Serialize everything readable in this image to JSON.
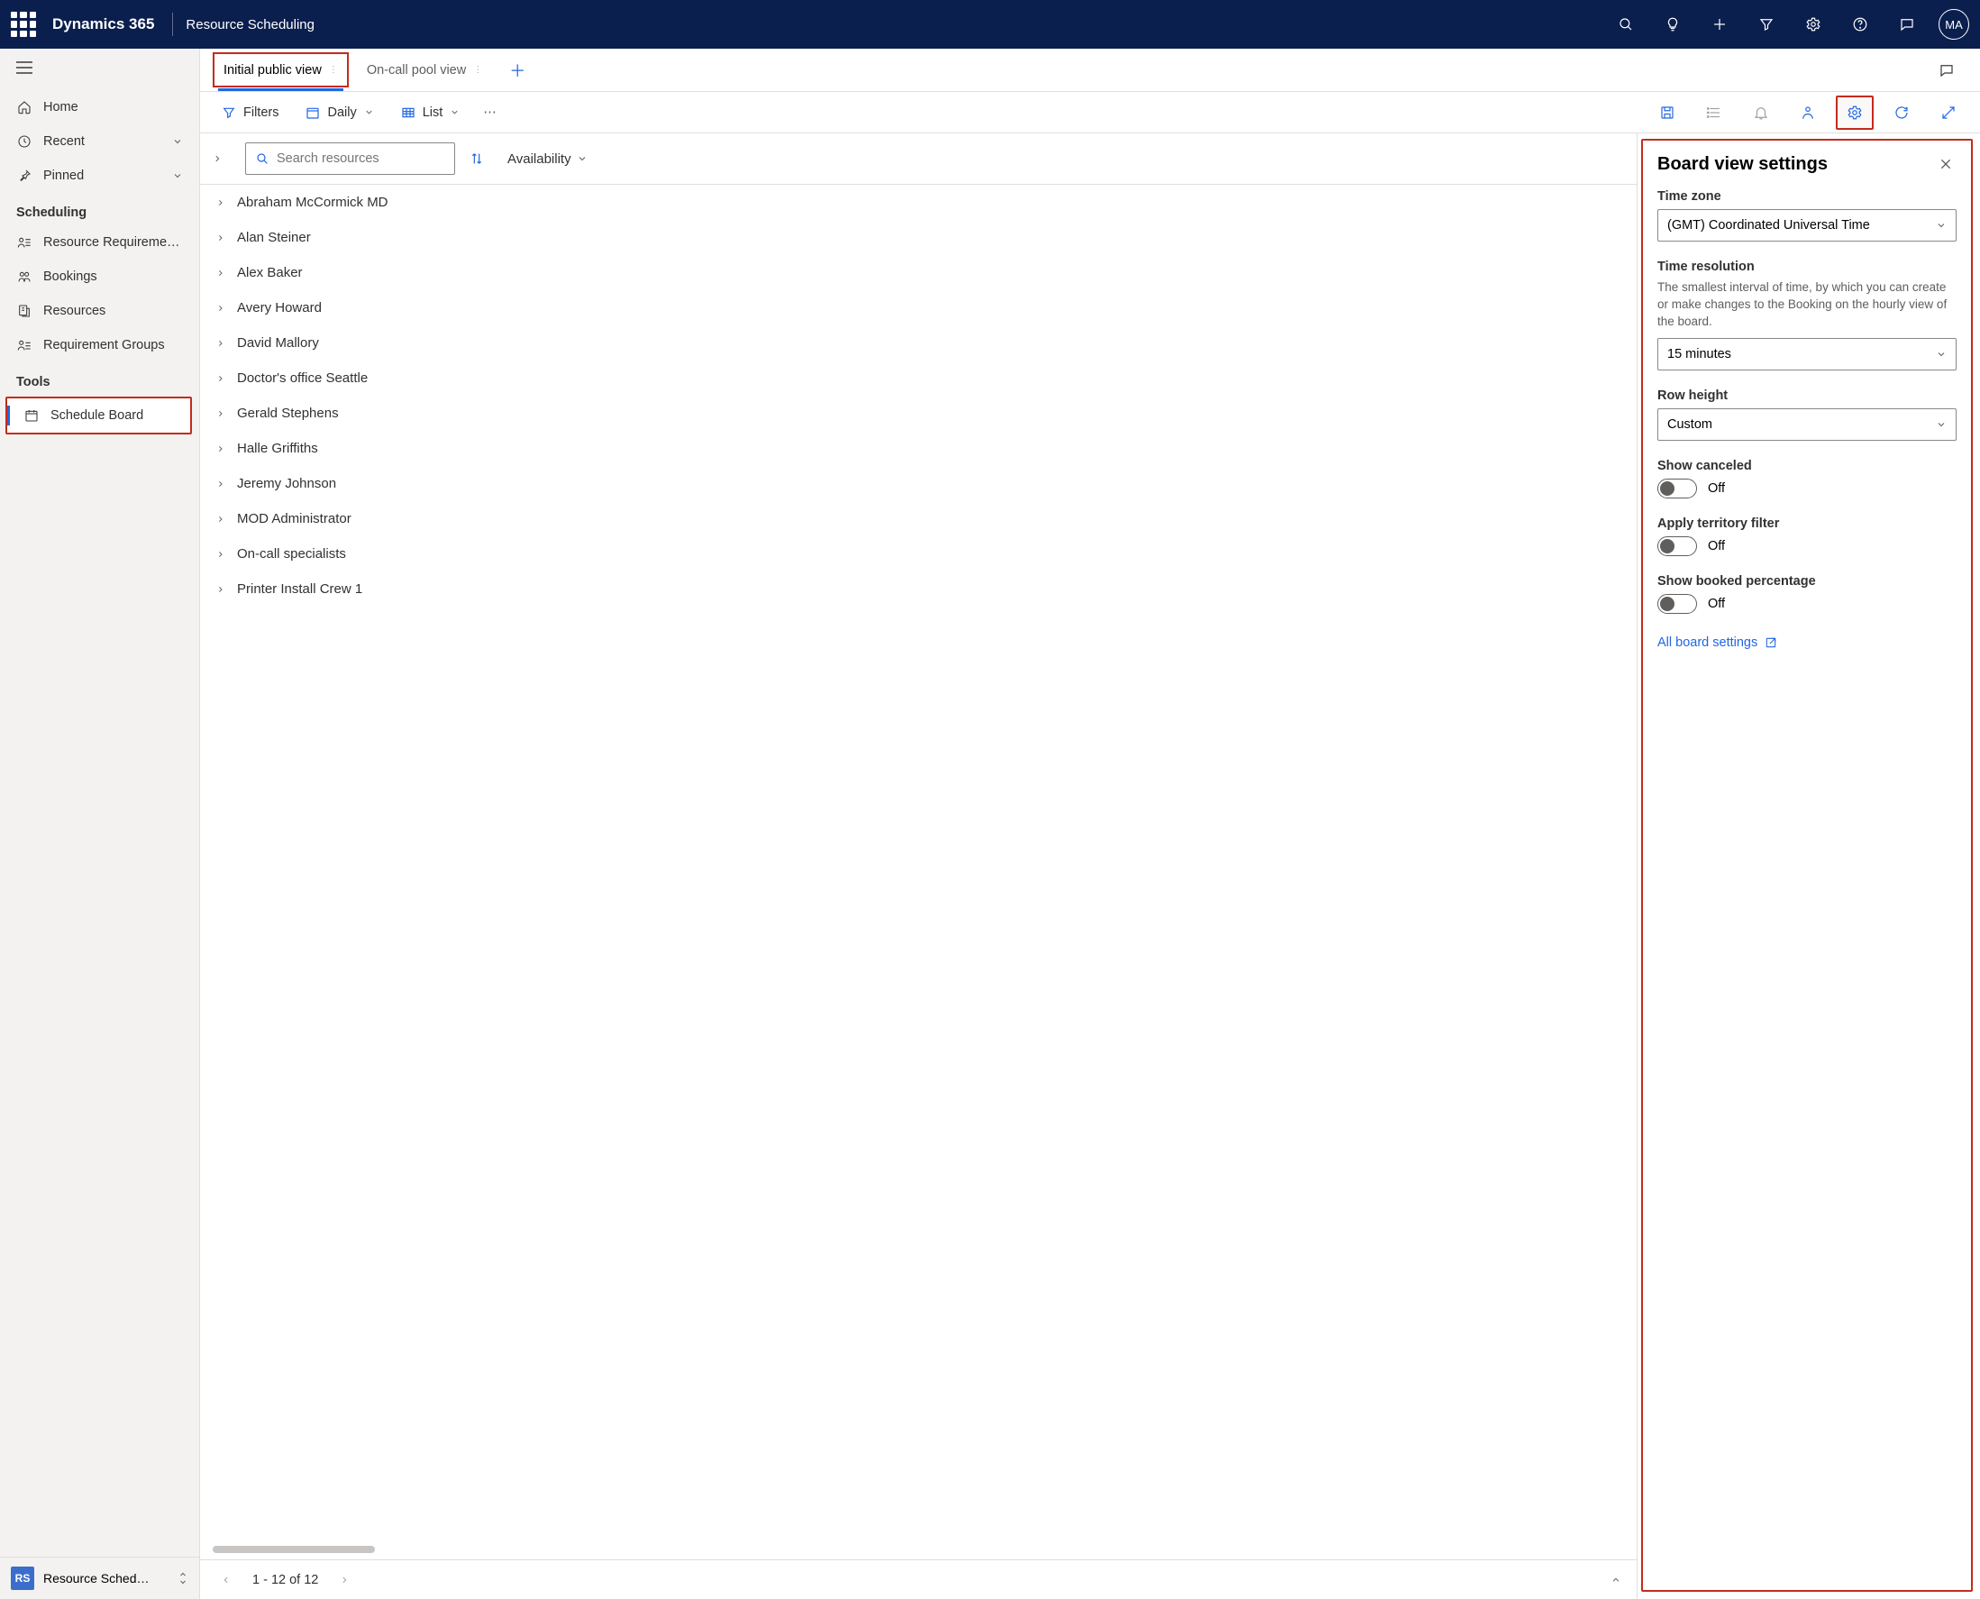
{
  "header": {
    "brand": "Dynamics 365",
    "app": "Resource Scheduling",
    "avatar": "MA"
  },
  "sidebar": {
    "items": {
      "home": "Home",
      "recent": "Recent",
      "pinned": "Pinned"
    },
    "scheduling_section": "Scheduling",
    "scheduling": {
      "resource_req": "Resource Requireme…",
      "bookings": "Bookings",
      "resources": "Resources",
      "requirement_groups": "Requirement Groups"
    },
    "tools_section": "Tools",
    "tools": {
      "schedule_board": "Schedule Board"
    },
    "footer": {
      "badge": "RS",
      "label": "Resource Schedul…"
    }
  },
  "tabs": {
    "t0": "Initial public view",
    "t1": "On-call pool view"
  },
  "toolbar": {
    "filters": "Filters",
    "daily": "Daily",
    "list": "List"
  },
  "search": {
    "placeholder": "Search resources",
    "availability": "Availability"
  },
  "resources": [
    "Abraham McCormick MD",
    "Alan Steiner",
    "Alex Baker",
    "Avery Howard",
    "David Mallory",
    "Doctor's office Seattle",
    "Gerald Stephens",
    "Halle Griffiths",
    "Jeremy Johnson",
    "MOD Administrator",
    "On-call specialists",
    "Printer Install Crew 1"
  ],
  "pager": {
    "range": "1 - 12 of 12"
  },
  "panel": {
    "title": "Board view settings",
    "timezone_label": "Time zone",
    "timezone_value": "(GMT) Coordinated Universal Time",
    "time_res_label": "Time resolution",
    "time_res_desc": "The smallest interval of time, by which you can create or make changes to the Booking on the hourly view of the board.",
    "time_res_value": "15 minutes",
    "row_height_label": "Row height",
    "row_height_value": "Custom",
    "show_canceled_label": "Show canceled",
    "show_canceled_state": "Off",
    "territory_label": "Apply territory filter",
    "territory_state": "Off",
    "booked_pct_label": "Show booked percentage",
    "booked_pct_state": "Off",
    "all_settings": "All board settings"
  }
}
